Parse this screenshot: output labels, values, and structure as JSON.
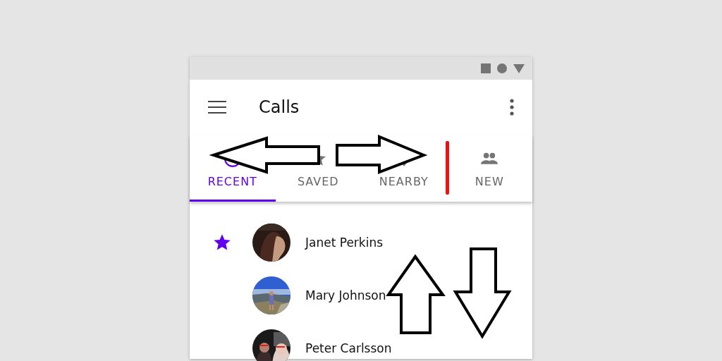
{
  "app_bar": {
    "title": "Calls"
  },
  "tabs": [
    {
      "label": "RECENT",
      "selected": true
    },
    {
      "label": "SAVED",
      "selected": false
    },
    {
      "label": "NEARBY",
      "selected": false
    },
    {
      "label": "NEW",
      "selected": false
    }
  ],
  "contacts": [
    {
      "name": "Janet Perkins",
      "starred": true,
      "kind": "picture"
    },
    {
      "name": "Mary Johnson",
      "starred": false,
      "kind": "picture"
    },
    {
      "name": "Peter Carlsson",
      "starred": false,
      "kind": "picture"
    }
  ],
  "annotations": [
    {
      "kind": "left"
    },
    {
      "kind": "right"
    },
    {
      "kind": "bar"
    },
    {
      "kind": "up"
    },
    {
      "kind": "down"
    }
  ]
}
